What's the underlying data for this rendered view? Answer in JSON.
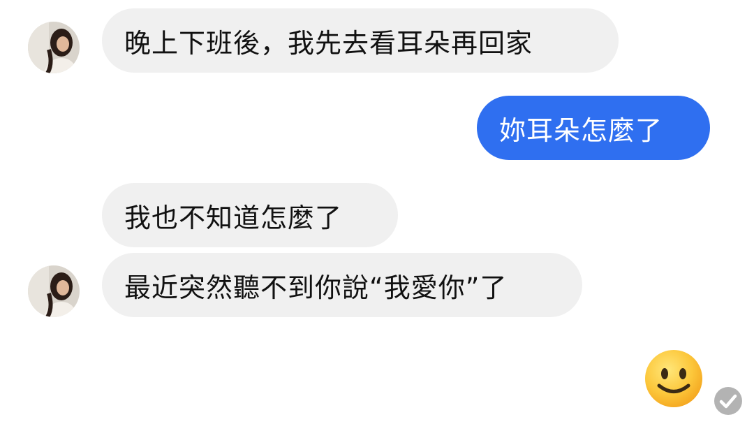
{
  "messages": [
    {
      "sender": "contact",
      "text": "晚上下班後，我先去看耳朵再回家"
    },
    {
      "sender": "me",
      "text": "妳耳朵怎麼了"
    },
    {
      "sender": "contact",
      "text": "我也不知道怎麼了"
    },
    {
      "sender": "contact",
      "text": "最近突然聽不到你說“我愛你”了"
    }
  ],
  "reaction": {
    "icon": "smiling-face-emoji"
  },
  "read_receipt": {
    "icon": "check-circle-icon",
    "state": "seen"
  },
  "colors": {
    "outgoing_bubble": "#2f6ff0",
    "incoming_bubble": "#f0f0f0",
    "background": "#ffffff"
  }
}
